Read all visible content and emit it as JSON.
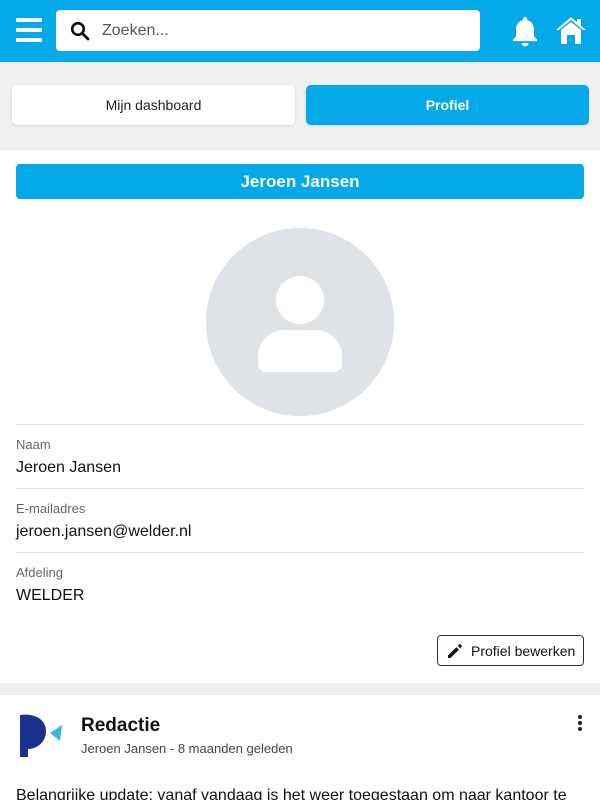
{
  "search": {
    "placeholder": "Zoeken..."
  },
  "header_icons": [
    "menu-icon",
    "search-icon",
    "bell-icon",
    "home-icon"
  ],
  "tabs": [
    {
      "label": "Mijn dashboard",
      "active": false
    },
    {
      "label": "Profiel",
      "active": true
    }
  ],
  "profile": {
    "name_banner": "Jeroen Jansen",
    "fields": [
      {
        "label": "Naam",
        "value": "Jeroen Jansen"
      },
      {
        "label": "E-mailadres",
        "value": "jeroen.jansen@welder.nl"
      },
      {
        "label": "Afdeling",
        "value": "WELDER"
      }
    ],
    "edit_button": "Profiel bewerken"
  },
  "post": {
    "author": "Redactie",
    "meta": "Jeroen Jansen - 8 maanden geleden",
    "text": "Belangrijke update: vanaf vandaag is het weer toegestaan om naar kantoor te"
  },
  "colors": {
    "accent": "#05a8e8",
    "logo_dark": "#1b2f8c",
    "logo_light": "#35b6e6"
  }
}
